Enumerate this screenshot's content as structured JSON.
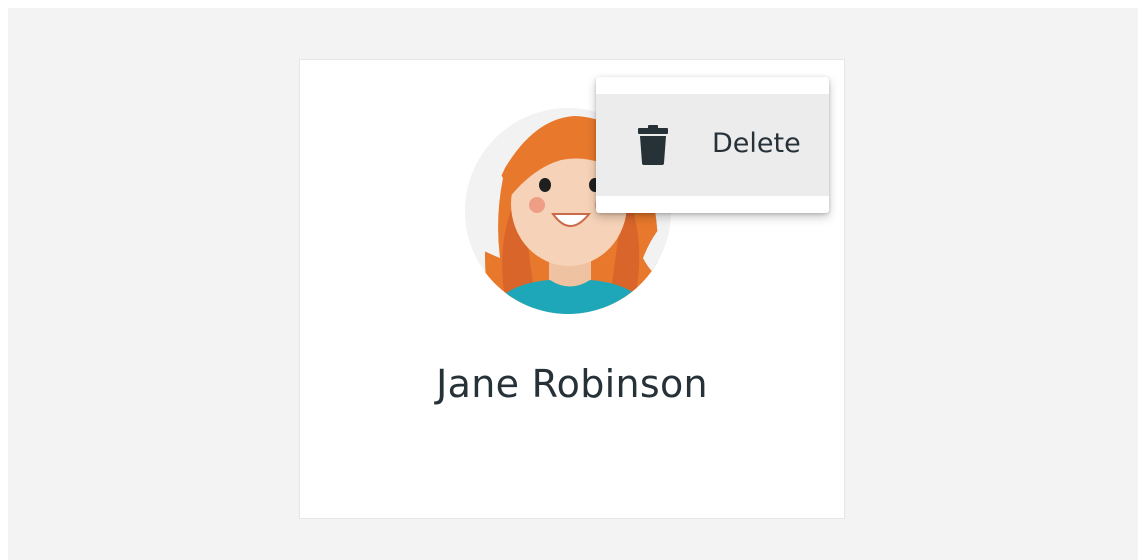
{
  "user": {
    "name": "Jane Robinson",
    "avatar_icon": "woman-avatar-illustration"
  },
  "context_menu": {
    "items": [
      {
        "label": "Delete",
        "icon": "trash-icon"
      }
    ]
  },
  "colors": {
    "background": "#f3f3f3",
    "card": "#ffffff",
    "menu_highlight": "#ececec",
    "text": "#263238",
    "hair": "#e8782c",
    "skin": "#f6d3b8",
    "shirt": "#1ea7b9"
  }
}
